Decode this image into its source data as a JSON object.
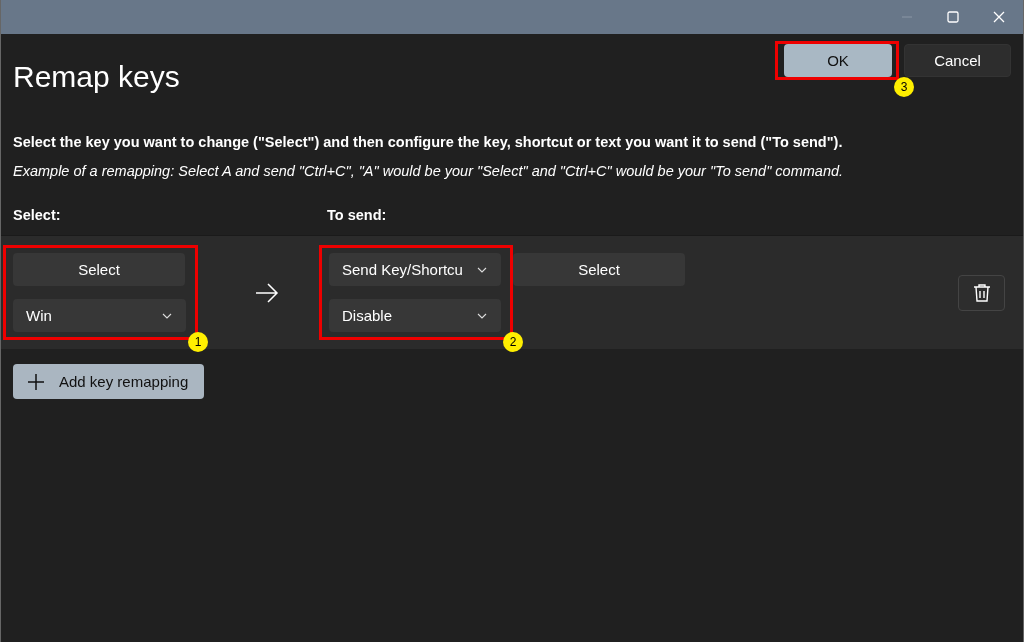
{
  "title": "Remap keys",
  "ok_button": {
    "label": "OK",
    "annotation": "3"
  },
  "cancel_button": {
    "label": "Cancel"
  },
  "instruction": "Select the key you want to change (\"Select\") and then configure the key, shortcut or text you want it to send (\"To send\").",
  "example": "Example of a remapping: Select A and send \"Ctrl+C\", \"A\" would be your \"Select\" and \"Ctrl+C\" would be your \"To send\" command.",
  "column_headers": [
    "Select:",
    "To send:"
  ],
  "rows": [
    {
      "select_button": "Select",
      "key_dropdown": "Win",
      "select_annotation": "1",
      "send_type_dropdown": "Send Key/Shortcu",
      "send_select_button": "Select",
      "send_value_dropdown": "Disable",
      "send_annotation": "2"
    }
  ],
  "add_button": "Add key remapping"
}
